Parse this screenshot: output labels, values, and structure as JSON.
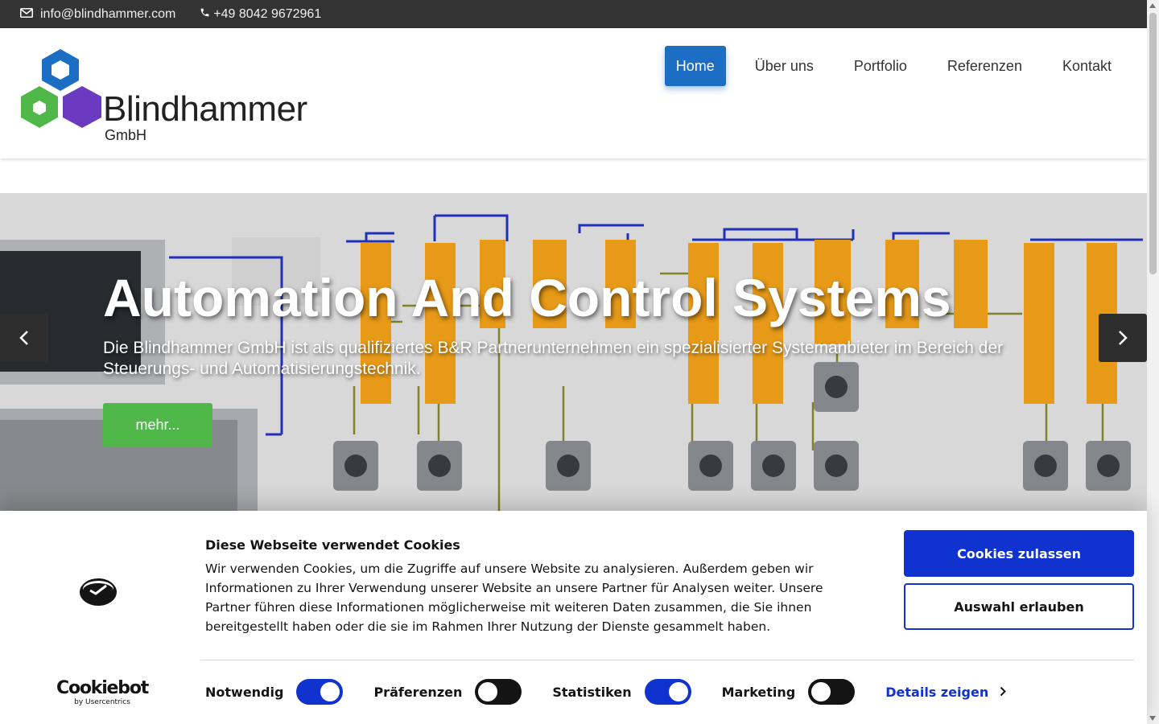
{
  "topbar": {
    "email": "info@blindhammer.com",
    "phone": "+49 8042 9672961",
    "email_icon": "envelope-icon",
    "phone_icon": "phone-icon"
  },
  "logo": {
    "name": "Blindhammer",
    "sub": "GmbH",
    "colors": {
      "blue": "#1c6dc4",
      "green": "#4fb848",
      "purple": "#6a3bc1"
    }
  },
  "nav": {
    "items": [
      {
        "label": "Home",
        "active": true
      },
      {
        "label": "Über uns",
        "active": false
      },
      {
        "label": "Portfolio",
        "active": false
      },
      {
        "label": "Referenzen",
        "active": false
      },
      {
        "label": "Kontakt",
        "active": false
      }
    ]
  },
  "hero": {
    "title": "Automation And Control Systems",
    "text": "Die Blindhammer GmbH ist als qualifiziertes B&R Partnerunternehmen ein spezialisierter Systemanbieter im Bereich der Steuerungs- und Automatisierungstechnik.",
    "button": "mehr...",
    "prev_icon": "chevron-left-icon",
    "next_icon": "chevron-right-icon"
  },
  "cookie": {
    "title": "Diese Webseite verwendet Cookies",
    "text": "Wir verwenden Cookies, um die Zugriffe auf unsere Website zu analysieren. Außerdem geben wir Informationen zu Ihrer Verwendung unserer Website an unsere Partner für Analysen weiter. Unsere Partner führen diese Informationen möglicherweise mit weiteren Daten zusammen, die Sie ihnen bereitgestellt haben oder die sie im Rahmen Ihrer Nutzung der Dienste gesammelt haben.",
    "allow_all": "Cookies zulassen",
    "allow_selection": "Auswahl erlauben",
    "brand": "Cookiebot",
    "brand_sub": "by Usercentrics",
    "toggles": [
      {
        "label": "Notwendig",
        "on": true
      },
      {
        "label": "Präferenzen",
        "on": false
      },
      {
        "label": "Statistiken",
        "on": true
      },
      {
        "label": "Marketing",
        "on": false
      }
    ],
    "details": "Details zeigen",
    "accent": "#1032cf"
  }
}
